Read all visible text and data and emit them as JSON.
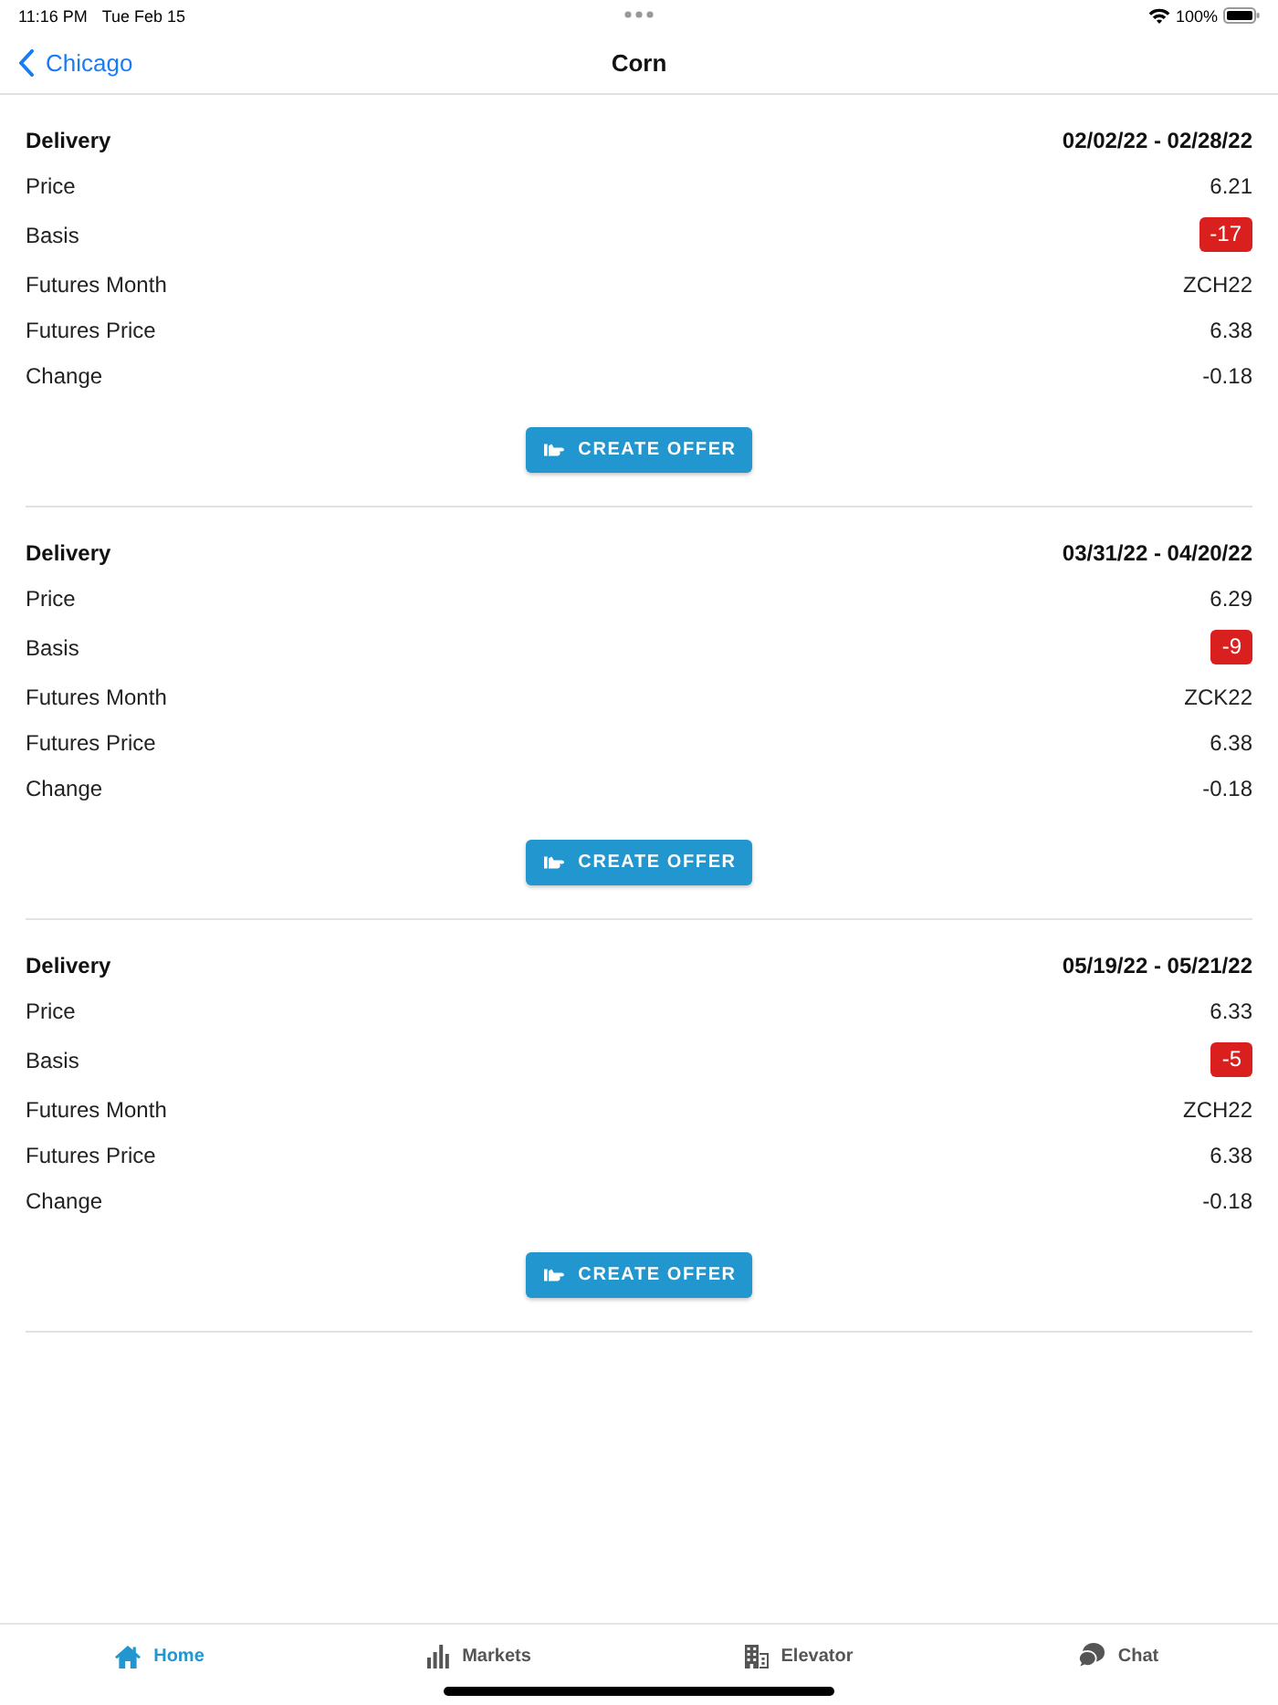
{
  "status_bar": {
    "time": "11:16 PM",
    "date": "Tue Feb 15",
    "battery": "100%"
  },
  "nav_bar": {
    "back_label": "Chicago",
    "title": "Corn"
  },
  "offers": [
    {
      "delivery_label": "Delivery",
      "delivery_dates": "02/02/22 - 02/28/22",
      "fields": [
        {
          "label": "Price",
          "value": "6.21",
          "kind": "plain"
        },
        {
          "label": "Basis",
          "value": "-17",
          "kind": "badge"
        },
        {
          "label": "Futures Month",
          "value": "ZCH22",
          "kind": "plain"
        },
        {
          "label": "Futures Price",
          "value": "6.38",
          "kind": "plain"
        },
        {
          "label": "Change",
          "value": "-0.18",
          "kind": "plain"
        }
      ],
      "button": "CREATE OFFER"
    },
    {
      "delivery_label": "Delivery",
      "delivery_dates": "03/31/22 - 04/20/22",
      "fields": [
        {
          "label": "Price",
          "value": "6.29",
          "kind": "plain"
        },
        {
          "label": "Basis",
          "value": "-9",
          "kind": "badge"
        },
        {
          "label": "Futures Month",
          "value": "ZCK22",
          "kind": "plain"
        },
        {
          "label": "Futures Price",
          "value": "6.38",
          "kind": "plain"
        },
        {
          "label": "Change",
          "value": "-0.18",
          "kind": "plain"
        }
      ],
      "button": "CREATE OFFER"
    },
    {
      "delivery_label": "Delivery",
      "delivery_dates": "05/19/22 - 05/21/22",
      "fields": [
        {
          "label": "Price",
          "value": "6.33",
          "kind": "plain"
        },
        {
          "label": "Basis",
          "value": "-5",
          "kind": "badge"
        },
        {
          "label": "Futures Month",
          "value": "ZCH22",
          "kind": "plain"
        },
        {
          "label": "Futures Price",
          "value": "6.38",
          "kind": "plain"
        },
        {
          "label": "Change",
          "value": "-0.18",
          "kind": "plain"
        }
      ],
      "button": "CREATE OFFER"
    }
  ],
  "tab_bar": [
    {
      "label": "Home",
      "kind": "home",
      "selected": true
    },
    {
      "label": "Markets",
      "kind": "markets",
      "selected": false
    },
    {
      "label": "Elevator",
      "kind": "elevator",
      "selected": false
    },
    {
      "label": "Chat",
      "kind": "chat",
      "selected": false
    }
  ]
}
